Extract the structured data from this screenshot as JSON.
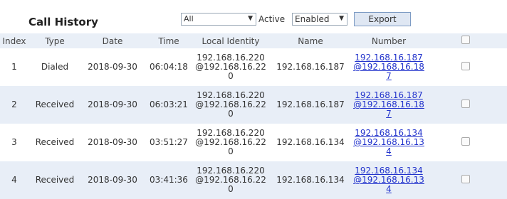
{
  "toolbar": {
    "title": "Call History",
    "filter_value": "All",
    "active_label": "Active",
    "active_value": "Enabled",
    "export_label": "Export"
  },
  "table": {
    "headers": [
      "Index",
      "Type",
      "Date",
      "Time",
      "Local Identity",
      "Name",
      "Number"
    ],
    "rows": [
      {
        "index": "1",
        "type": "Dialed",
        "date": "2018-09-30",
        "time": "06:04:18",
        "local_identity": "192.168.16.220@192.168.16.220",
        "name": "192.168.16.187",
        "number": "192.168.16.187@192.168.16.187"
      },
      {
        "index": "2",
        "type": "Received",
        "date": "2018-09-30",
        "time": "06:03:21",
        "local_identity": "192.168.16.220@192.168.16.220",
        "name": "192.168.16.187",
        "number": "192.168.16.187@192.168.16.187"
      },
      {
        "index": "3",
        "type": "Received",
        "date": "2018-09-30",
        "time": "03:51:27",
        "local_identity": "192.168.16.220@192.168.16.220",
        "name": "192.168.16.134",
        "number": "192.168.16.134@192.168.16.134"
      },
      {
        "index": "4",
        "type": "Received",
        "date": "2018-09-30",
        "time": "03:41:36",
        "local_identity": "192.168.16.220@192.168.16.220",
        "name": "192.168.16.134",
        "number": "192.168.16.134@192.168.16.134"
      }
    ]
  }
}
